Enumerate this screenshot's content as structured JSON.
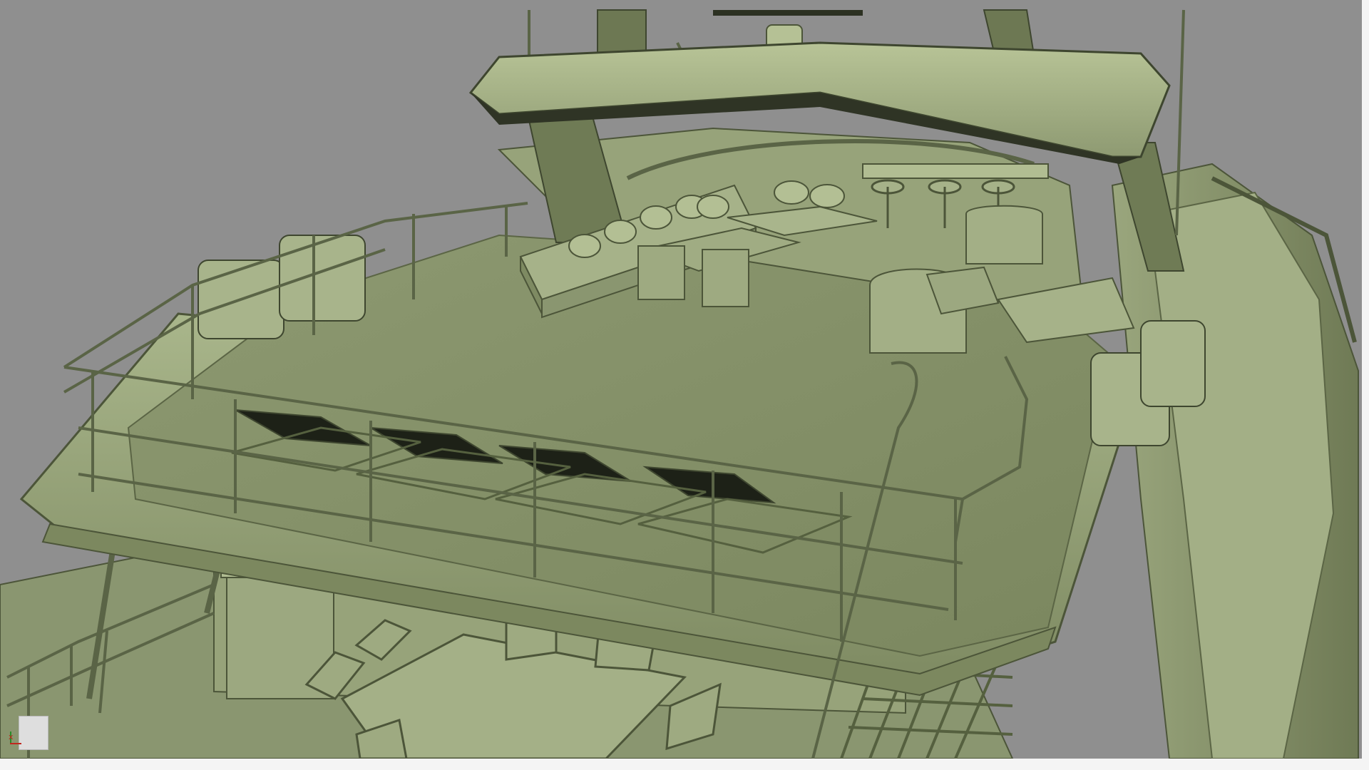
{
  "viewport": {
    "scene_description_hidden": "",
    "background_color": "#8f8f8f",
    "model_color": "#9aa77e",
    "model_shadow_color": "#5f6a4a",
    "model_highlight_color": "#c4cfa0",
    "dark_color": "#262a1d"
  },
  "axis_gizmo": {
    "x_label": "x"
  }
}
